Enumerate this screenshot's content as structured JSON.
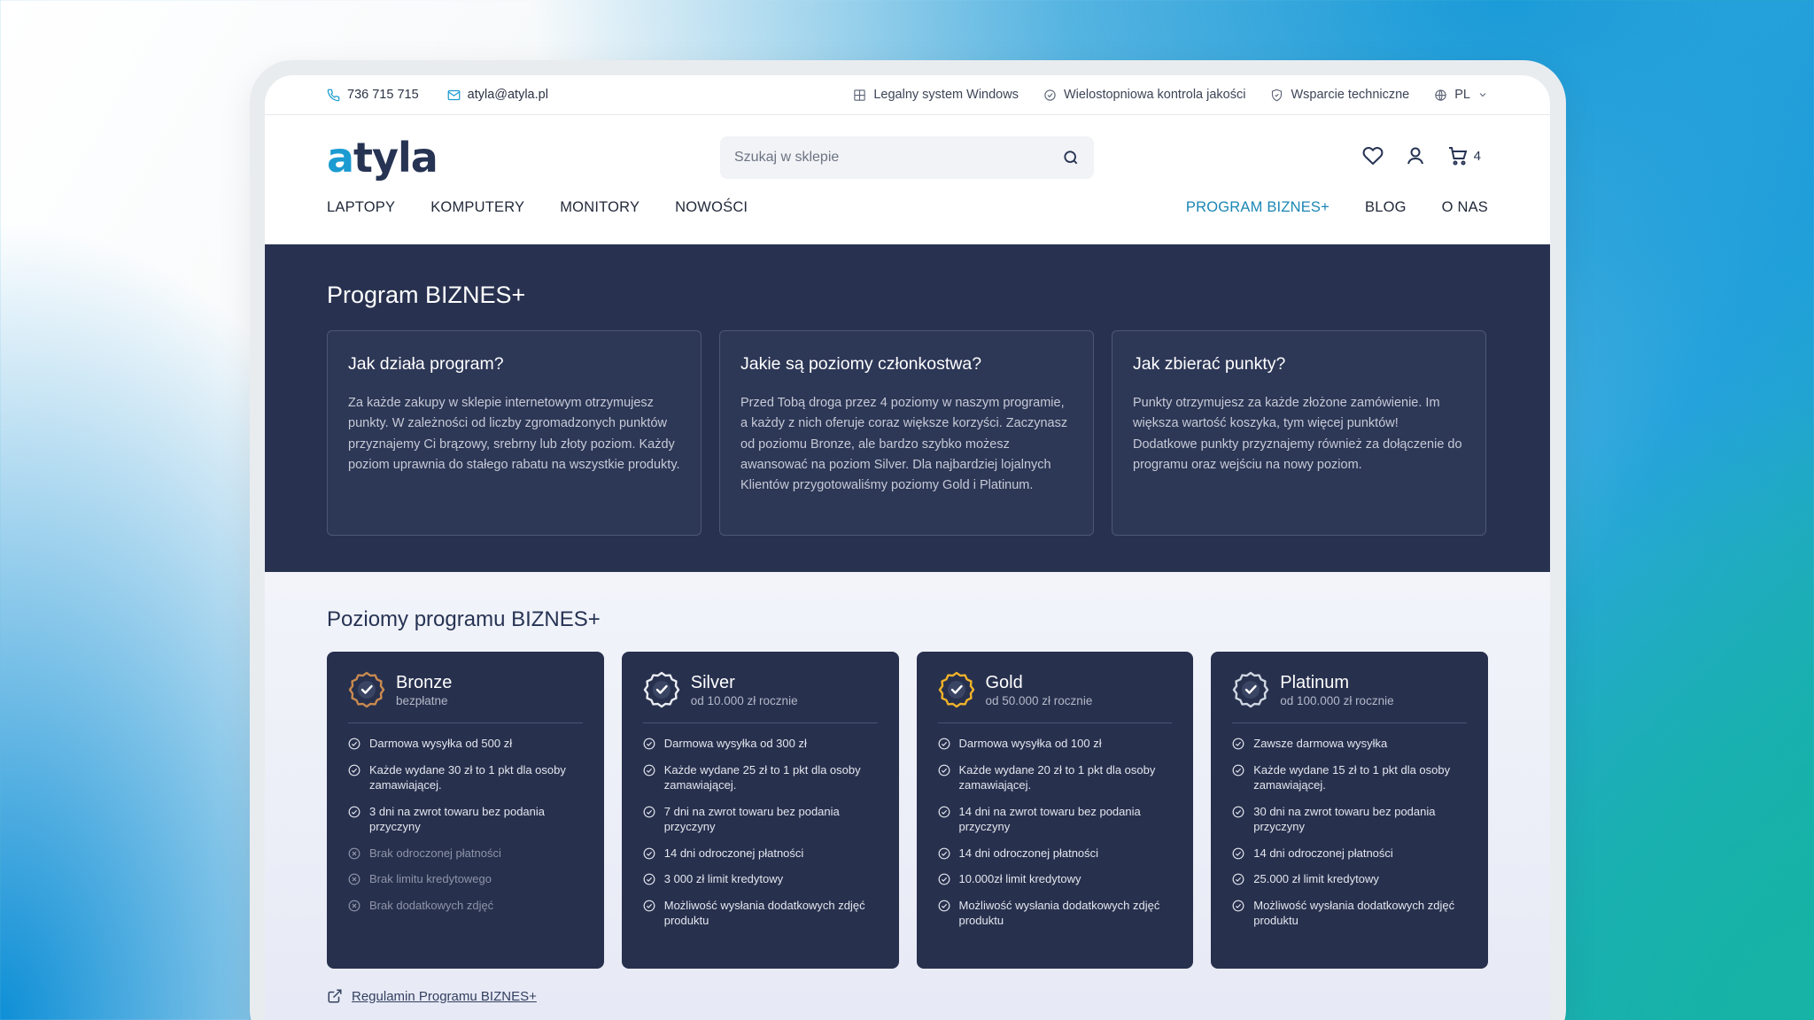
{
  "topbar": {
    "phone": "736 715 715",
    "email": "atyla@atyla.pl",
    "benefits": [
      "Legalny system Windows",
      "Wielostopniowa kontrola jakości",
      "Wsparcie techniczne"
    ],
    "language": "PL"
  },
  "header": {
    "logo_accent": "a",
    "logo_rest": "tyla",
    "search_placeholder": "Szukaj w sklepie",
    "cart_count": "4"
  },
  "nav": {
    "left": [
      "LAPTOPY",
      "KOMPUTERY",
      "MONITORY",
      "NOWOŚCI"
    ],
    "right": [
      "PROGRAM BIZNES+",
      "BLOG",
      "O NAS"
    ]
  },
  "program": {
    "title": "Program BIZNES+",
    "cards": [
      {
        "title": "Jak działa program?",
        "text": "Za każde zakupy w sklepie internetowym otrzymujesz punkty. W zależności od liczby zgromadzonych punktów przyznajemy Ci brązowy, srebrny lub złoty poziom. Każdy poziom uprawnia do stałego rabatu na wszystkie produkty."
      },
      {
        "title": "Jakie są poziomy członkostwa?",
        "text": "Przed Tobą droga przez 4 poziomy w naszym programie, a każdy z nich oferuje coraz większe korzyści. Zaczynasz od poziomu Bronze, ale bardzo szybko możesz awansować na poziom Silver. Dla najbardziej lojalnych Klientów przygotowaliśmy poziomy Gold i Platinum."
      },
      {
        "title": "Jak zbierać punkty?",
        "text": "Punkty otrzymujesz za każde złożone zamówienie. Im większa wartość koszyka, tym więcej punktów! Dodatkowe punkty przyznajemy również za dołączenie do programu oraz wejściu na nowy poziom."
      }
    ]
  },
  "levels": {
    "title": "Poziomy programu BIZNES+",
    "tiers": [
      {
        "name": "Bronze",
        "price": "bezpłatne",
        "color": "#c98a4f",
        "features": [
          {
            "text": "Darmowa wysyłka od 500 zł",
            "on": true
          },
          {
            "text": "Każde wydane 30 zł to 1 pkt dla osoby zamawiającej.",
            "on": true
          },
          {
            "text": "3 dni na zwrot towaru bez podania przyczyny",
            "on": true
          },
          {
            "text": "Brak odroczonej płatności",
            "on": false
          },
          {
            "text": "Brak limitu kredytowego",
            "on": false
          },
          {
            "text": "Brak dodatkowych zdjęć",
            "on": false
          }
        ]
      },
      {
        "name": "Silver",
        "price": "od 10.000 zł rocznie",
        "color": "#e9ecf2",
        "features": [
          {
            "text": "Darmowa wysyłka od 300 zł",
            "on": true
          },
          {
            "text": "Każde wydane 25 zł to 1 pkt dla osoby zamawiającej.",
            "on": true
          },
          {
            "text": "7 dni na zwrot towaru bez podania przyczyny",
            "on": true
          },
          {
            "text": "14 dni odroczonej płatności",
            "on": true
          },
          {
            "text": "3 000 zł limit kredytowy",
            "on": true
          },
          {
            "text": "Możliwość wysłania dodatkowych zdjęć produktu",
            "on": true
          }
        ]
      },
      {
        "name": "Gold",
        "price": "od 50.000 zł rocznie",
        "color": "#f0b32a",
        "features": [
          {
            "text": "Darmowa wysyłka od 100 zł",
            "on": true
          },
          {
            "text": "Każde wydane 20 zł to 1 pkt dla osoby zamawiającej.",
            "on": true
          },
          {
            "text": "14 dni na zwrot towaru bez podania przyczyny",
            "on": true
          },
          {
            "text": "14 dni odroczonej płatności",
            "on": true
          },
          {
            "text": "10.000zł limit kredytowy",
            "on": true
          },
          {
            "text": "Możliwość wysłania dodatkowych zdjęć produktu",
            "on": true
          }
        ]
      },
      {
        "name": "Platinum",
        "price": "od 100.000 zł rocznie",
        "color": "#cfd6e2",
        "features": [
          {
            "text": "Zawsze darmowa wysyłka",
            "on": true
          },
          {
            "text": "Każde wydane 15 zł to 1 pkt dla osoby zamawiającej.",
            "on": true
          },
          {
            "text": "30 dni na zwrot towaru bez podania przyczyny",
            "on": true
          },
          {
            "text": "14 dni odroczonej płatności",
            "on": true
          },
          {
            "text": "25.000 zł limit kredytowy",
            "on": true
          },
          {
            "text": "Możliwość wysłania dodatkowych zdjęć produktu",
            "on": true
          }
        ]
      }
    ],
    "terms_link": "Regulamin Programu BIZNES+"
  }
}
